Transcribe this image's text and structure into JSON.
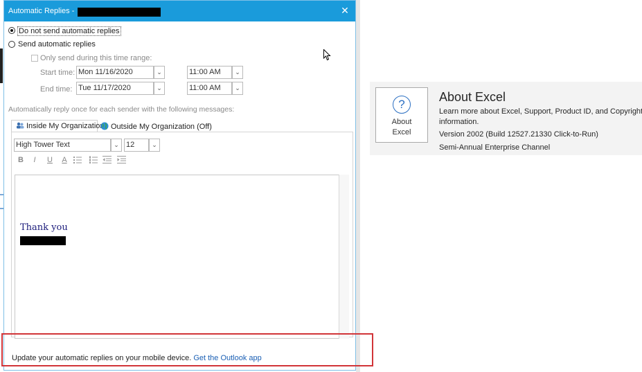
{
  "dialog": {
    "title": "Automatic Replies - ",
    "close_glyph": "✕",
    "radio_no_send": "Do not send automatic replies",
    "radio_send": "Send automatic replies",
    "only_send_label": "Only send during this time range:",
    "start_time_label": "Start time:",
    "end_time_label": "End time:",
    "start_date": "Mon 11/16/2020",
    "start_time": "11:00 AM",
    "end_date": "Tue 11/17/2020",
    "end_time": "11:00 AM",
    "instruction": "Automatically reply once for each sender with the following messages:",
    "tabs": [
      {
        "label": "Inside My Organization"
      },
      {
        "label": "Outside My Organization (Off)"
      }
    ],
    "font_name": "High Tower Text",
    "font_size": "12",
    "toolbar": {
      "bold": "B",
      "italic": "I",
      "underline": "U",
      "font_color": "A"
    },
    "message_text": "Thank you",
    "footer_text": "Update your automatic replies on your mobile device.",
    "footer_link": "Get the Outlook app"
  },
  "about": {
    "tile_label": "About Excel",
    "title": "About Excel",
    "description": "Learn more about Excel, Support, Product ID, and Copyright",
    "description_cont": "information.",
    "version": "Version 2002 (Build 12527.21330 Click-to-Run)",
    "channel": "Semi-Annual Enterprise Channel"
  },
  "colors": {
    "titlebar": "#1a9bdb",
    "highlight": "#d13438",
    "link": "#1a5fb4"
  }
}
